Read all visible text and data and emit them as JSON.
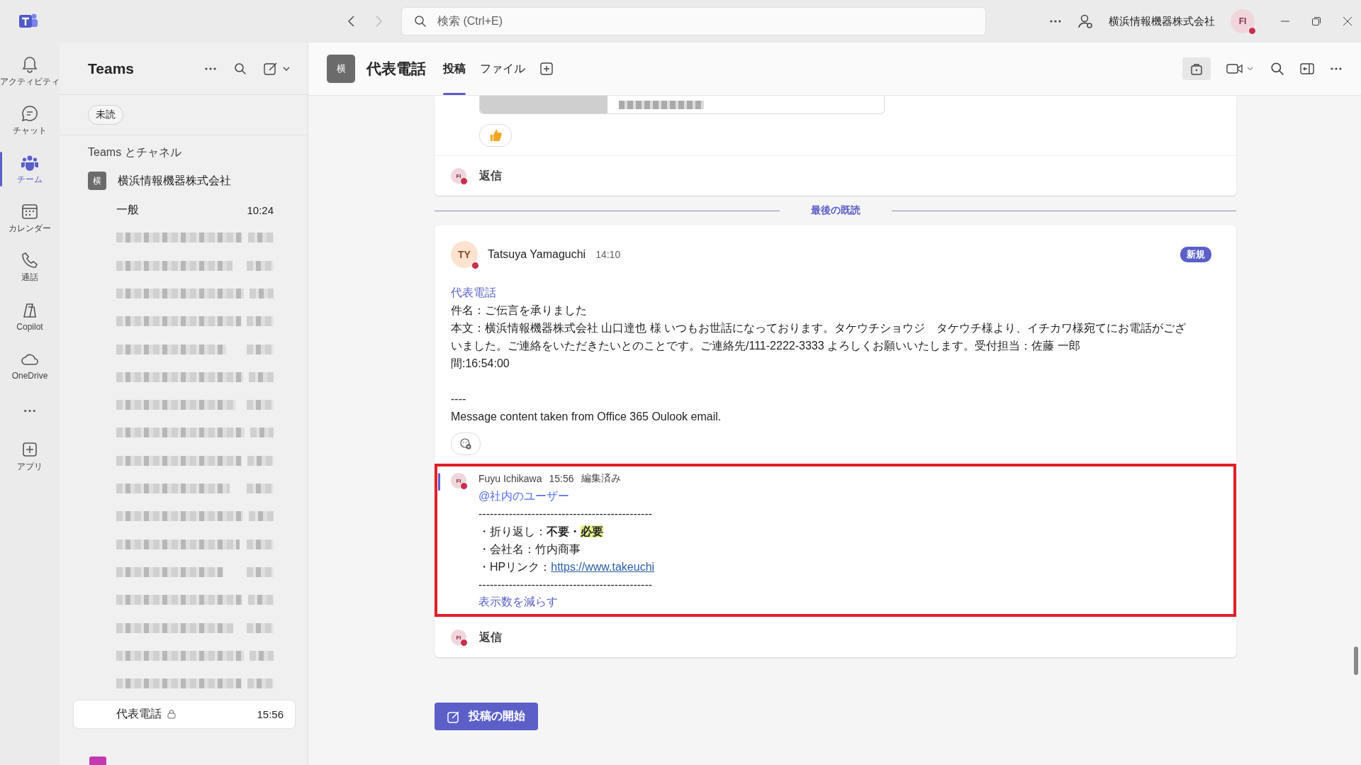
{
  "titlebar": {
    "search": {
      "placeholder": "検索 (Ctrl+E)"
    },
    "org_name": "横浜情報機器株式会社",
    "avatar": {
      "initials": "FI"
    }
  },
  "rail": [
    {
      "kind": "item",
      "label": "アクティビティ",
      "selected": false
    },
    {
      "kind": "item",
      "label": "チャット",
      "selected": false
    },
    {
      "kind": "item",
      "label": "チーム",
      "selected": true
    },
    {
      "kind": "item",
      "label": "カレンダー",
      "selected": false
    },
    {
      "kind": "item",
      "label": "通話",
      "selected": false
    },
    {
      "kind": "item",
      "label": "Copilot",
      "selected": false
    },
    {
      "kind": "item",
      "label": "OneDrive",
      "selected": false
    },
    {
      "kind": "more",
      "selected": false
    },
    {
      "kind": "item",
      "label": "アプリ",
      "selected": false
    }
  ],
  "sidebar": {
    "title": "Teams",
    "filter": "未読",
    "section": "Teams とチャネル",
    "team": {
      "avatar": "横",
      "name": "横浜情報機器株式会社"
    },
    "channels": [
      {
        "kind": "channel",
        "name": "一般",
        "time": "10:24",
        "selected": false,
        "locked": false
      },
      {
        "kind": "blurred"
      },
      {
        "kind": "blurred"
      },
      {
        "kind": "blurred"
      },
      {
        "kind": "blurred"
      },
      {
        "kind": "blurred"
      },
      {
        "kind": "blurred"
      },
      {
        "kind": "blurred"
      },
      {
        "kind": "blurred"
      },
      {
        "kind": "blurred"
      },
      {
        "kind": "blurred"
      },
      {
        "kind": "blurred"
      },
      {
        "kind": "blurred"
      },
      {
        "kind": "blurred"
      },
      {
        "kind": "blurred"
      },
      {
        "kind": "blurred"
      },
      {
        "kind": "blurred"
      },
      {
        "kind": "blurred"
      },
      {
        "kind": "channel",
        "name": "代表電話",
        "time": "15:56",
        "selected": true,
        "locked": true
      }
    ]
  },
  "channel_header": {
    "avatar": "横",
    "title": "代表電話",
    "tabs": [
      {
        "label": "投稿",
        "selected": true
      },
      {
        "label": "ファイル",
        "selected": false
      }
    ]
  },
  "feed": {
    "previous_post": {
      "reply_label": "返信",
      "reply_avatar": {
        "initials": "FI"
      }
    },
    "divider": "最後の既読",
    "post": {
      "avatar": {
        "initials": "TY"
      },
      "author": "Tatsuya Yamaguchi",
      "time": "14:10",
      "badge": "新規",
      "subject_link": "代表電話",
      "lines": [
        "件名：ご伝言を承りました",
        "本文：横浜情報機器株式会社 山口達也 様 いつもお世話になっております。タケウチショウジ　タケウチ様より、イチカワ様宛てにお電話がございました。ご連絡をいただきたいとのことです。ご連絡先/111-2222-3333 よろしくお願いいたします。受付担当：佐藤 一郎",
        "間:16:54:00"
      ],
      "footer": [
        "----",
        "Message content taken from Office 365 Oulook email."
      ],
      "reply": {
        "highlighted": true,
        "avatar": {
          "initials": "FI"
        },
        "author": "Fuyu Ichikawa",
        "time": "15:56",
        "edited": "編集済み",
        "lines": [
          {
            "kind": "mention",
            "text": "@社内のユーザー"
          },
          {
            "kind": "text",
            "text": "----------------------------------------------"
          },
          {
            "kind": "choice",
            "label": "・折り返し：",
            "options": [
              {
                "text": "不要・",
                "selected": false
              },
              {
                "text": "必要",
                "selected": true
              }
            ]
          },
          {
            "kind": "text",
            "text": "・会社名：竹内商事"
          },
          {
            "kind": "link",
            "label": "・HPリンク：",
            "url": "https://www.takeuchi"
          },
          {
            "kind": "text",
            "text": "----------------------------------------------"
          }
        ],
        "collapse": "表示数を減らす"
      },
      "reply_label": "返信",
      "reply_avatar": {
        "initials": "FI"
      }
    },
    "new_post_button": "投稿の開始"
  }
}
